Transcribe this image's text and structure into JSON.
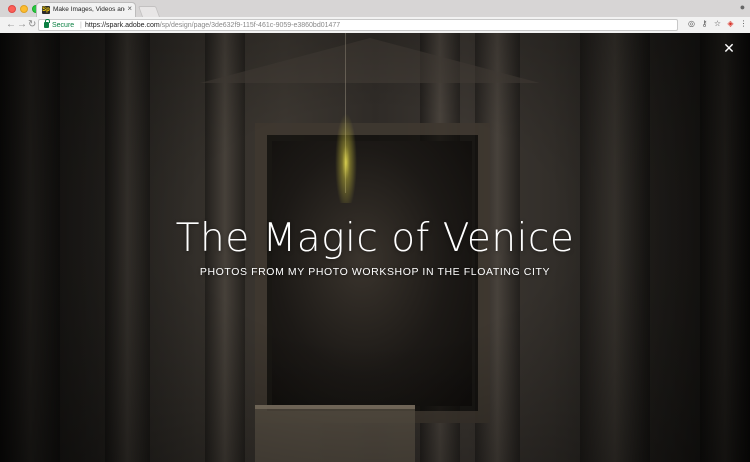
{
  "browser": {
    "tab": {
      "favicon_text": "Sp",
      "title": "Make Images, Videos and Web",
      "close_glyph": "×"
    },
    "nav": {
      "back_glyph": "←",
      "forward_glyph": "→",
      "reload_glyph": "↻"
    },
    "address": {
      "secure_label": "Secure",
      "separator": "|",
      "url_host": "https://spark.adobe.com",
      "url_path": "/sp/design/page/3de632f9-115f-461c-9059-e3860bd01477"
    },
    "toolbar_icons": {
      "ext1_glyph": "◎",
      "key_glyph": "⚷",
      "star_glyph": "☆",
      "ext2_glyph": "◈",
      "menu_glyph": "⋮",
      "profile_glyph": "●"
    }
  },
  "hero": {
    "close_glyph": "✕",
    "title": "The Magic of Venice",
    "subtitle": "PHOTOS FROM MY PHOTO WORKSHOP IN THE FLOATING CITY"
  },
  "colors": {
    "secure_green": "#0b8043",
    "hero_text": "#ffffff"
  }
}
